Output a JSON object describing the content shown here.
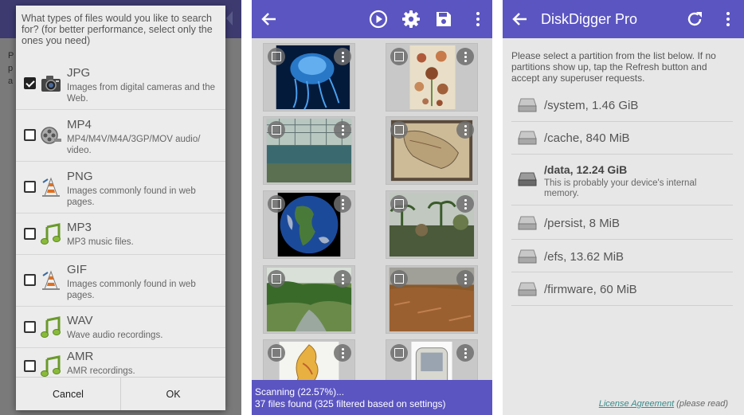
{
  "dialog": {
    "question": "What types of files would you like to search for? (for better performance, select only the ones you need)",
    "file_types": [
      {
        "name": "JPG",
        "desc": "Images from digital cameras and the Web.",
        "checked": true,
        "icon": "camera-icon"
      },
      {
        "name": "MP4",
        "desc": "MP4/M4V/M4A/3GP/MOV audio/ video.",
        "checked": false,
        "icon": "film-reel-icon"
      },
      {
        "name": "PNG",
        "desc": "Images commonly found in web pages.",
        "checked": false,
        "icon": "vlc-cone-icon"
      },
      {
        "name": "MP3",
        "desc": "MP3 music files.",
        "checked": false,
        "icon": "music-note-icon"
      },
      {
        "name": "GIF",
        "desc": "Images commonly found in web pages.",
        "checked": false,
        "icon": "vlc-cone-icon"
      },
      {
        "name": "WAV",
        "desc": "Wave audio recordings.",
        "checked": false,
        "icon": "music-note-icon"
      },
      {
        "name": "AMR",
        "desc": "AMR recordings.",
        "checked": false,
        "icon": "music-note-icon"
      }
    ],
    "cancel_label": "Cancel",
    "ok_label": "OK"
  },
  "scan": {
    "toolbar_icons": [
      "back-arrow-icon",
      "play-icon",
      "gear-icon",
      "save-icon",
      "overflow-menu-icon"
    ],
    "thumbnails": [
      "jellyfish-thumbnail",
      "botanical-illustration-thumbnail",
      "indoor-pool-thumbnail",
      "old-map-thumbnail",
      "earth-globe-thumbnail",
      "jungle-landscape-thumbnail",
      "forest-river-thumbnail",
      "autumn-field-thumbnail",
      "map-of-lebanon-thumbnail",
      "retro-computer-thumbnail"
    ],
    "status_line1": "Scanning (22.57%)...",
    "status_line2": "37 files found (325 filtered based on settings)",
    "accent": "#5b55c2"
  },
  "partitions": {
    "title": "DiskDigger Pro",
    "intro": "Please select a partition from the list below. If no partitions show up, tap the Refresh button and accept any superuser requests.",
    "items": [
      {
        "name": "/system, 1.46 GiB",
        "desc": "",
        "bold": false
      },
      {
        "name": "/cache, 840 MiB",
        "desc": "",
        "bold": false
      },
      {
        "name": "/data, 12.24 GiB",
        "desc": "This is probably your device's internal memory.",
        "bold": true
      },
      {
        "name": "/persist, 8 MiB",
        "desc": "",
        "bold": false
      },
      {
        "name": "/efs, 13.62 MiB",
        "desc": "",
        "bold": false
      },
      {
        "name": "/firmware, 60 MiB",
        "desc": "",
        "bold": false
      }
    ],
    "license_link": "License Agreement",
    "license_suffix": " (please read)"
  }
}
